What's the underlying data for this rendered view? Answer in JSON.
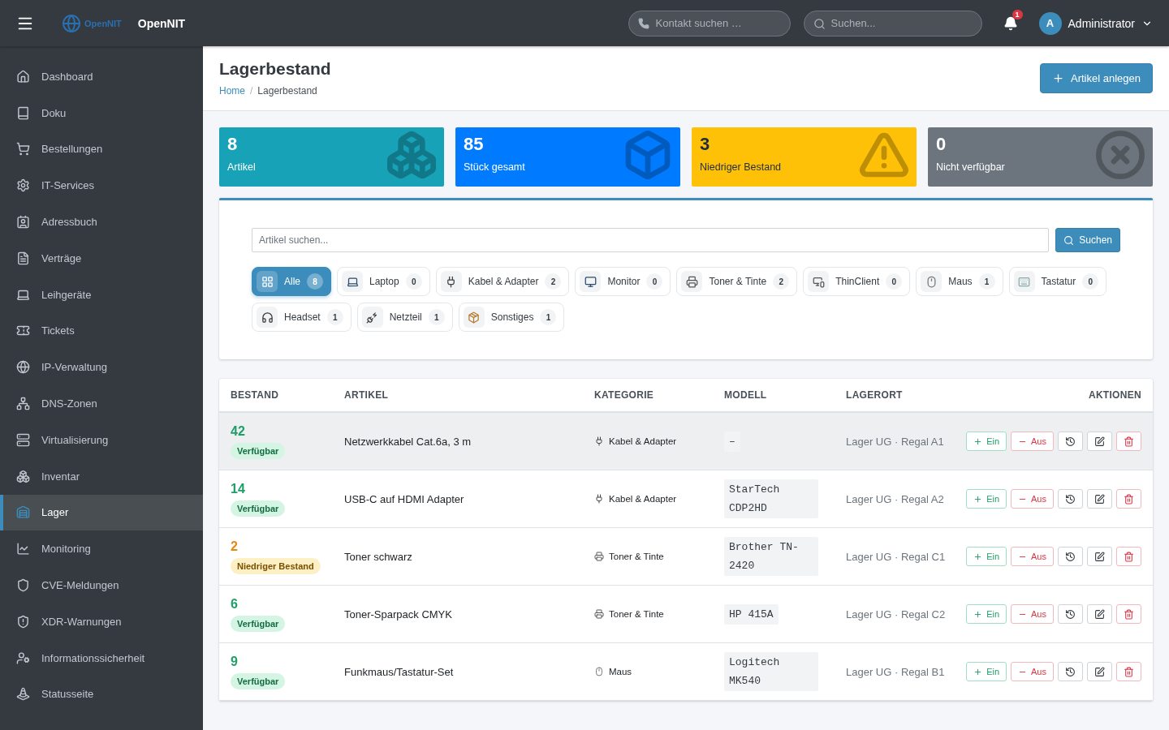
{
  "topbar": {
    "brand_logo_text": "OpenNIT",
    "brand": "OpenNIT",
    "contact_search": {
      "placeholder": "Kontakt suchen …"
    },
    "search": {
      "placeholder": "Suchen..."
    },
    "notifications": "1",
    "user": {
      "avatar": "A",
      "name": "Administrator"
    }
  },
  "sidebar": {
    "items": [
      {
        "label": "Dashboard",
        "kind": "home",
        "selected": false
      },
      {
        "label": "Doku",
        "kind": "book",
        "selected": false
      },
      {
        "label": "Bestellungen",
        "kind": "cart",
        "selected": false
      },
      {
        "label": "IT-Services",
        "kind": "gear",
        "selected": false
      },
      {
        "label": "Adressbuch",
        "kind": "contacts",
        "selected": false
      },
      {
        "label": "Verträge",
        "kind": "contract",
        "selected": false
      },
      {
        "label": "Leihgeräte",
        "kind": "laptop",
        "selected": false
      },
      {
        "label": "Tickets",
        "kind": "ticket",
        "selected": false
      },
      {
        "label": "IP-Verwaltung",
        "kind": "globe",
        "selected": false
      },
      {
        "label": "DNS-Zonen",
        "kind": "network",
        "selected": false
      },
      {
        "label": "Virtualisierung",
        "kind": "server",
        "selected": false
      },
      {
        "label": "Inventar",
        "kind": "boxes",
        "selected": false
      },
      {
        "label": "Lager",
        "kind": "warehouse",
        "selected": true
      },
      {
        "label": "Monitoring",
        "kind": "chart",
        "selected": false
      },
      {
        "label": "CVE-Meldungen",
        "kind": "shield",
        "selected": false
      },
      {
        "label": "XDR-Warnungen",
        "kind": "shieldalert",
        "selected": false
      },
      {
        "label": "Informationssicherheit",
        "kind": "usershield",
        "selected": false
      },
      {
        "label": "Statusseite",
        "kind": "traffic",
        "selected": false
      }
    ]
  },
  "page": {
    "title": "Lagerbestand",
    "breadcrumb": {
      "items": [
        "Home",
        "Lagerbestand"
      ],
      "separator": "/"
    },
    "primary_button": "Artikel anlegen"
  },
  "stats": [
    {
      "value": "8",
      "label": "Artikel",
      "color": "#17a2b8",
      "kind": "boxes"
    },
    {
      "value": "85",
      "label": "Stück gesamt",
      "color": "#007bff",
      "kind": "cubes"
    },
    {
      "value": "3",
      "label": "Niedriger Bestand",
      "color": "#ffc107",
      "kind": "warning"
    },
    {
      "value": "0",
      "label": "Nicht verfügbar",
      "color": "#6c757d",
      "kind": "cross"
    }
  ],
  "filter": {
    "search": {
      "placeholder": "Artikel suchen..."
    },
    "search_button": "Suchen",
    "categories": [
      {
        "label": "Alle",
        "count": "8",
        "kind": "all",
        "selected": true
      },
      {
        "label": "Laptop",
        "count": "0",
        "kind": "laptop",
        "selected": false
      },
      {
        "label": "Kabel & Adapter",
        "count": "2",
        "kind": "plug",
        "selected": false
      },
      {
        "label": "Monitor",
        "count": "0",
        "kind": "monitor",
        "selected": false
      },
      {
        "label": "Toner & Tinte",
        "count": "2",
        "kind": "printer",
        "selected": false
      },
      {
        "label": "ThinClient",
        "count": "0",
        "kind": "thinclient",
        "selected": false
      },
      {
        "label": "Maus",
        "count": "1",
        "kind": "mouse",
        "selected": false
      },
      {
        "label": "Tastatur",
        "count": "0",
        "kind": "keyboard",
        "selected": false
      },
      {
        "label": "Headset",
        "count": "1",
        "kind": "headset",
        "selected": false
      },
      {
        "label": "Netzteil",
        "count": "1",
        "kind": "power",
        "selected": false
      },
      {
        "label": "Sonstiges",
        "count": "1",
        "kind": "package",
        "selected": false
      }
    ]
  },
  "table": {
    "columns": [
      "BESTAND",
      "ARTIKEL",
      "KATEGORIE",
      "MODELL",
      "LAGERORT",
      "AKTIONEN"
    ],
    "rows": [
      {
        "stock": "42",
        "status": {
          "label": "Verfügbar",
          "kind": "ok"
        },
        "article": "Netzwerkkabel Cat.6a, 3 m",
        "category": {
          "label": "Kabel & Adapter",
          "kind": "plug"
        },
        "model": "–",
        "location": "Lager UG · Regal A1",
        "selected": true,
        "in": "Ein",
        "out": "Aus"
      },
      {
        "stock": "14",
        "status": {
          "label": "Verfügbar",
          "kind": "ok"
        },
        "article": "USB-C auf HDMI Adapter",
        "category": {
          "label": "Kabel & Adapter",
          "kind": "plug"
        },
        "model": "StarTech CDP2HD",
        "location": "Lager UG · Regal A2",
        "selected": false,
        "in": "Ein",
        "out": "Aus"
      },
      {
        "stock": "2",
        "status": {
          "label": "Niedriger Bestand",
          "kind": "low"
        },
        "article": "Toner schwarz",
        "category": {
          "label": "Toner & Tinte",
          "kind": "printer"
        },
        "model": "Brother TN-2420",
        "location": "Lager UG · Regal C1",
        "selected": false,
        "in": "Ein",
        "out": "Aus"
      },
      {
        "stock": "6",
        "status": {
          "label": "Verfügbar",
          "kind": "ok"
        },
        "article": "Toner-Sparpack CMYK",
        "category": {
          "label": "Toner & Tinte",
          "kind": "printer"
        },
        "model": "HP 415A",
        "location": "Lager UG · Regal C2",
        "selected": false,
        "in": "Ein",
        "out": "Aus"
      },
      {
        "stock": "9",
        "status": {
          "label": "Verfügbar",
          "kind": "ok"
        },
        "article": "Funkmaus/Tastatur-Set",
        "category": {
          "label": "Maus",
          "kind": "mouse"
        },
        "model": "Logitech MK540",
        "location": "Lager UG · Regal B1",
        "selected": false,
        "in": "Ein",
        "out": "Aus"
      }
    ]
  }
}
